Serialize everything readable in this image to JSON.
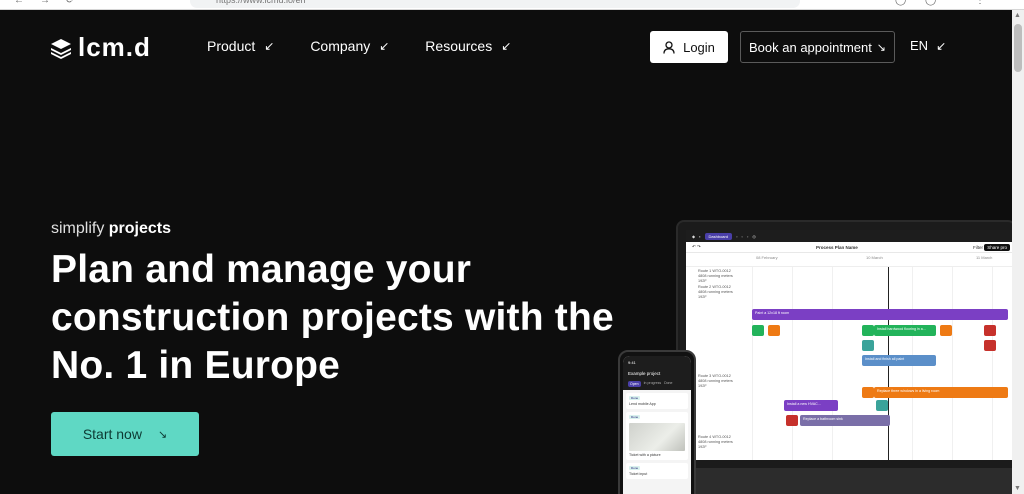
{
  "browser": {
    "url": "https://www.lcmd.io/en"
  },
  "header": {
    "logo_text": "lcm.d",
    "nav": [
      {
        "label": "Product"
      },
      {
        "label": "Company"
      },
      {
        "label": "Resources"
      }
    ],
    "login_label": "Login",
    "book_label": "Book an appointment",
    "lang_label": "EN"
  },
  "hero": {
    "subtitle_prefix": "simplify ",
    "subtitle_bold": "projects",
    "headline": "Plan and manage your construction projects with the No. 1 in Europe",
    "cta_label": "Start now"
  },
  "app_preview": {
    "toolbar_tab": "Dashboard",
    "plan_title": "Process Plan Name",
    "filter_label": "Filter",
    "share_label": "Share pro",
    "months": [
      "08 February",
      "10 March",
      "11 March"
    ],
    "rows": [
      "Route 1 WTO-0012 4808 running meters 192F",
      "Route 2 WTO-0012 4808 running meters 192F",
      "Route 3 WTO-0012 4808 running meters 192F",
      "Route 4 WTO-0012 4808 running meters 192F"
    ],
    "bars": [
      {
        "label": "Paint a 12x18 ft room"
      },
      {
        "label": "Install hardwood flooring in a..."
      },
      {
        "label": "Install and finish all paint"
      },
      {
        "label": "Replace three windows in a living room"
      },
      {
        "label": "Install a new HVAC..."
      },
      {
        "label": "Replace a bathroom sink"
      }
    ]
  },
  "phone_preview": {
    "time": "9:41",
    "title": "Example project",
    "tabs": [
      "Open",
      "In progress",
      "Done"
    ],
    "cards": [
      {
        "tag": "Done",
        "title": "Lend mobile App"
      },
      {
        "tag": "Done",
        "title": "Ticket with a picture"
      },
      {
        "tag": "Done",
        "title": "Ticket input"
      }
    ]
  },
  "colors": {
    "background": "#0d0d0d",
    "cta": "#5fd8c4",
    "purple": "#7b3fc4",
    "green": "#22b35a",
    "orange": "#ee7a14",
    "blue": "#5b8fc9",
    "red": "#c6312b",
    "teal": "#3aa39a"
  },
  "icons": {
    "login": "user-icon",
    "book": "arrow-down-right-icon",
    "nav_arrow": "arrow-down-left-icon",
    "cta": "arrow-down-right-icon"
  }
}
